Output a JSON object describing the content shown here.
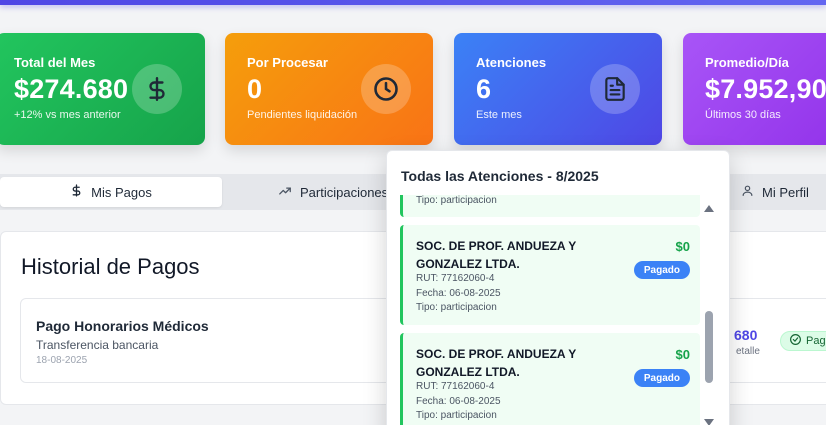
{
  "cards": [
    {
      "label": "Total del Mes",
      "value": "$274.680",
      "sub": "+12% vs mes anterior",
      "icon": "dollar-icon"
    },
    {
      "label": "Por Procesar",
      "value": "0",
      "sub": "Pendientes liquidación",
      "icon": "clock-icon"
    },
    {
      "label": "Atenciones",
      "value": "6",
      "sub": "Este mes",
      "icon": "document-icon"
    },
    {
      "label": "Promedio/Día",
      "value": "$7.952,90",
      "sub": "Últimos 30 días"
    }
  ],
  "tabs": [
    {
      "label": "Mis Pagos",
      "icon": "dollar-icon"
    },
    {
      "label": "Participaciones",
      "icon": "trend-up-icon"
    },
    {
      "label": "Mi Perfil",
      "icon": "user-icon"
    }
  ],
  "history": {
    "title": "Historial de Pagos",
    "payment": {
      "title": "Pago Honorarios Médicos",
      "method": "Transferencia bancaria",
      "date": "18-08-2025",
      "amount": "680",
      "detail": "etalle",
      "status": "Paga"
    }
  },
  "popup": {
    "title": "Todas las Atenciones - 8/2025",
    "partial_item": {
      "tipo": "Tipo: participacion"
    },
    "items": [
      {
        "name": "SOC. DE PROF. ANDUEZA Y GONZALEZ LTDA.",
        "rut": "RUT: 77162060-4",
        "fecha": "Fecha: 06-08-2025",
        "tipo": "Tipo: participacion",
        "amount": "$0",
        "status": "Pagado"
      },
      {
        "name": "SOC. DE PROF. ANDUEZA Y GONZALEZ LTDA.",
        "rut": "RUT: 77162060-4",
        "fecha": "Fecha: 06-08-2025",
        "tipo": "Tipo: participacion",
        "amount": "$0",
        "status": "Pagado"
      }
    ]
  },
  "colors": {
    "green": "#16a34a",
    "orange": "#f97316",
    "blue": "#4f46e5",
    "purple": "#9333ea",
    "badge_blue": "#3b82f6"
  }
}
